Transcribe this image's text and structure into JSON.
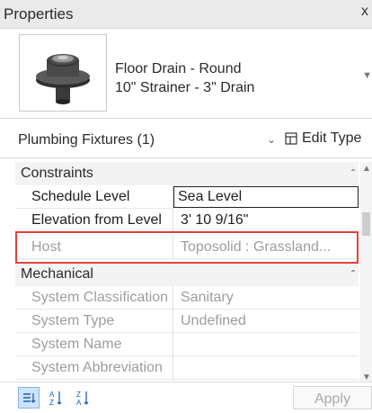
{
  "panel": {
    "title": "Properties",
    "close_glyph": "x"
  },
  "type_selector": {
    "thumbnail_icon": "floor-drain-3d-icon",
    "family": "Floor Drain - Round",
    "type": "10\" Strainer - 3\" Drain"
  },
  "filter": {
    "label": "Plumbing Fixtures (1)",
    "edit_type_label": "Edit Type"
  },
  "sections": {
    "constraints": {
      "title": "Constraints",
      "rows": [
        {
          "name": "Schedule Level",
          "value": "Sea Level"
        },
        {
          "name": "Elevation from Level",
          "value": "3'  10 9/16\""
        },
        {
          "name": "Host",
          "value": "Toposolid : Grassland..."
        }
      ]
    },
    "mechanical": {
      "title": "Mechanical",
      "rows": [
        {
          "name": "System Classification",
          "value": "Sanitary"
        },
        {
          "name": "System Type",
          "value": "Undefined"
        },
        {
          "name": "System Name",
          "value": ""
        },
        {
          "name": "System Abbreviation",
          "value": ""
        }
      ]
    }
  },
  "footer": {
    "apply_label": "Apply"
  },
  "colors": {
    "highlight": "#e0413b",
    "accent": "#1d5fb3",
    "disabled_text": "#9d9d9d"
  }
}
